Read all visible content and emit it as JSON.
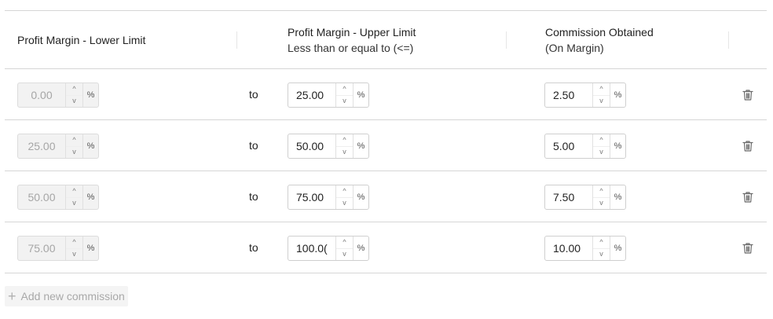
{
  "header": {
    "lower_limit": "Profit Margin - Lower Limit",
    "upper_limit": "Profit Margin - Upper Limit",
    "upper_limit_sub": "Less than or equal to (<=)",
    "commission": "Commission Obtained",
    "commission_sub": "(On Margin)"
  },
  "to_label": "to",
  "unit": "%",
  "up_arrow": "^",
  "down_arrow": "v",
  "rows": [
    {
      "lower": "0.00",
      "upper": "25.00",
      "commission": "2.50"
    },
    {
      "lower": "25.00",
      "upper": "50.00",
      "commission": "5.00"
    },
    {
      "lower": "50.00",
      "upper": "75.00",
      "commission": "7.50"
    },
    {
      "lower": "75.00",
      "upper": "100.0(",
      "commission": "10.00"
    }
  ],
  "add_button": {
    "icon": "plus-icon",
    "label": "Add new commission"
  },
  "delete_icon": "trash-icon"
}
